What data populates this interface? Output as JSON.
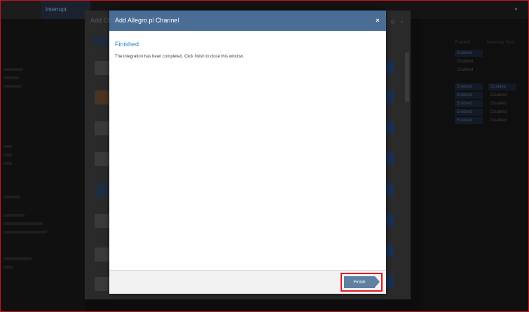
{
  "background": {
    "app_tab": "Interrupt",
    "panel_title": "Add Ch",
    "right_headers": [
      "Enabled",
      "Inventory Sync"
    ],
    "cell_on": "Enabled",
    "cell_off": "Disabled"
  },
  "modal": {
    "title": "Add Allegro.pl Channel",
    "close_glyph": "×",
    "step_title": "Finished",
    "message": "The integration has been completed. Click finish to close this window.",
    "finish_label": "Finish"
  },
  "colors": {
    "header": "#4a6d96",
    "step_title": "#2e86c8",
    "button": "#5f7fa3",
    "highlight": "#e11a22"
  }
}
